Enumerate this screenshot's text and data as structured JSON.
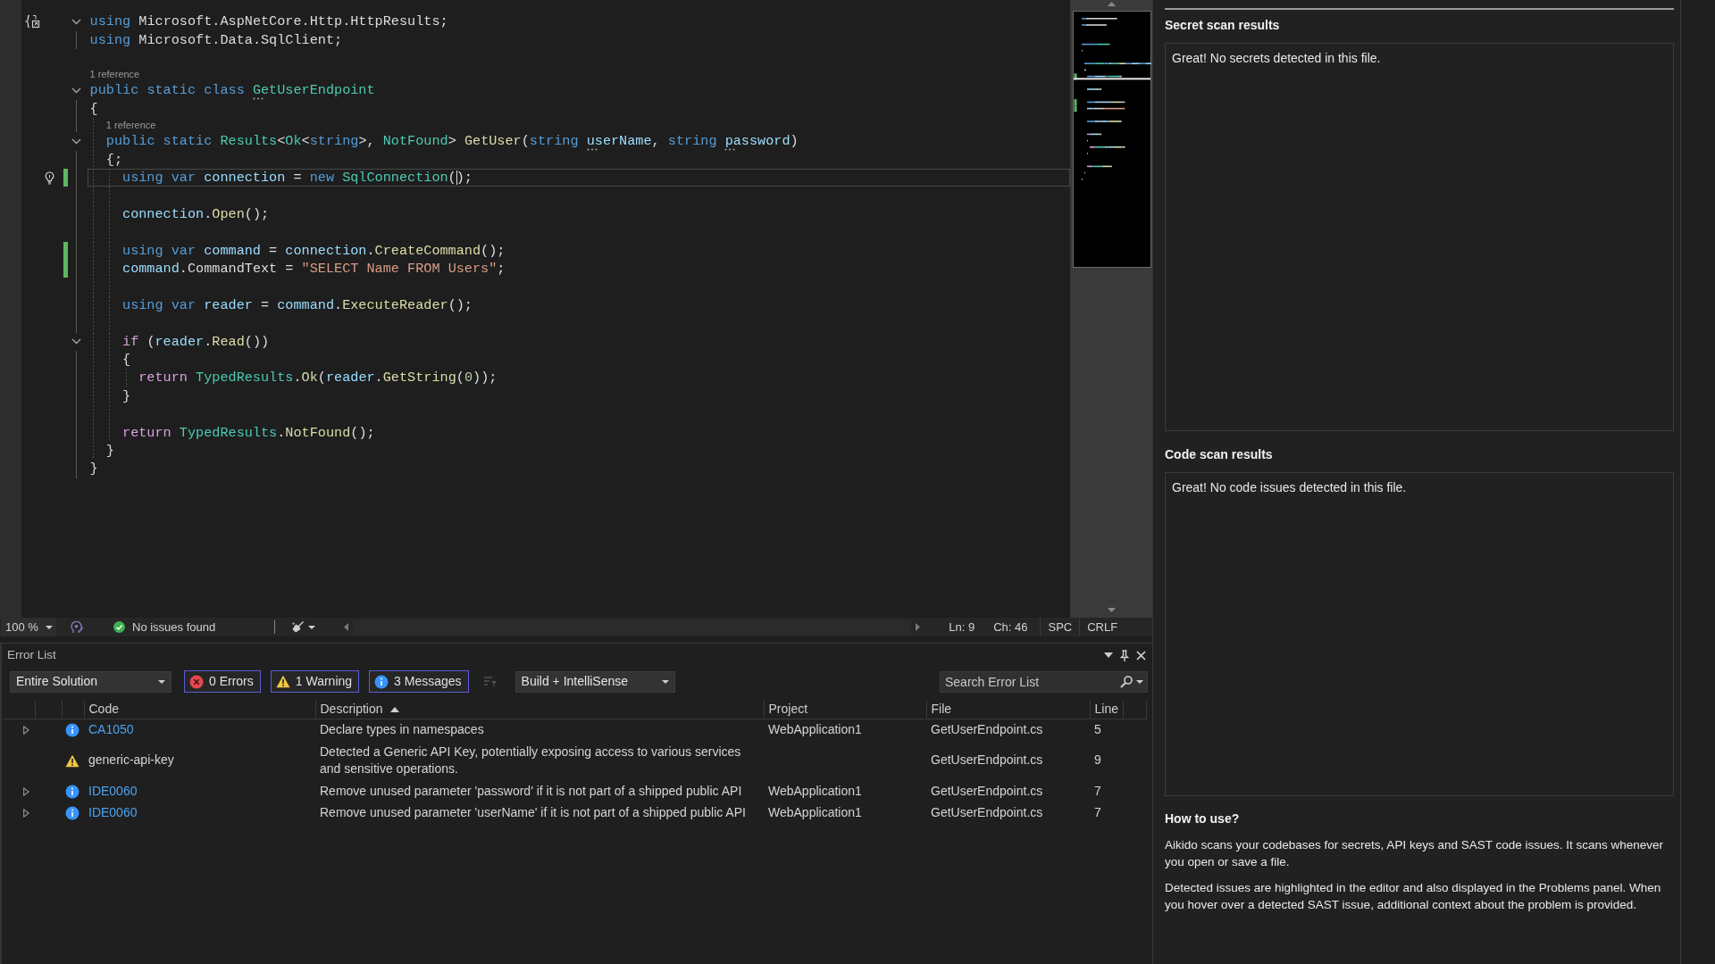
{
  "editor": {
    "lines": [
      {
        "kind": "code",
        "fold": true,
        "modified": false,
        "current": false,
        "tokens": [
          {
            "text": "using",
            "kind": "keyword"
          },
          {
            "text": " Microsoft.AspNetCore.Http.HttpResults;",
            "kind": "plain"
          }
        ]
      },
      {
        "kind": "code",
        "fold": false,
        "modified": false,
        "current": false,
        "tokens": [
          {
            "text": "using",
            "kind": "keyword"
          },
          {
            "text": " Microsoft.Data.SqlClient;",
            "kind": "plain"
          }
        ]
      },
      {
        "kind": "blank",
        "fold": false,
        "modified": false,
        "current": false
      },
      {
        "kind": "codelens",
        "fold": false,
        "modified": false,
        "current": false,
        "text": "1 reference"
      },
      {
        "kind": "code",
        "fold": true,
        "modified": false,
        "current": false,
        "tokens": [
          {
            "text": "public static class ",
            "kind": "keyword"
          },
          {
            "text": "GetUserEndpoint",
            "kind": "type",
            "dotted": true
          }
        ]
      },
      {
        "kind": "code",
        "fold": false,
        "modified": false,
        "current": false,
        "tokens": [
          {
            "text": "{",
            "kind": "plain"
          }
        ],
        "children": [
          {
            "kind": "codelens",
            "fold": false,
            "modified": false,
            "current": false,
            "text": "1 reference"
          },
          {
            "kind": "code",
            "fold": true,
            "modified": false,
            "current": false,
            "tokens": [
              {
                "text": "public static ",
                "kind": "keyword"
              },
              {
                "text": "Results",
                "kind": "type"
              },
              {
                "text": "<",
                "kind": "plain"
              },
              {
                "text": "Ok",
                "kind": "type"
              },
              {
                "text": "<",
                "kind": "plain"
              },
              {
                "text": "string",
                "kind": "keyword"
              },
              {
                "text": ">, ",
                "kind": "plain"
              },
              {
                "text": "NotFound",
                "kind": "type"
              },
              {
                "text": "> ",
                "kind": "plain"
              },
              {
                "text": "GetUser",
                "kind": "method"
              },
              {
                "text": "(",
                "kind": "plain"
              },
              {
                "text": "string ",
                "kind": "keyword"
              },
              {
                "text": "userName",
                "kind": "variable",
                "dotted": true
              },
              {
                "text": ", ",
                "kind": "plain"
              },
              {
                "text": "string ",
                "kind": "keyword"
              },
              {
                "text": "password",
                "kind": "variable",
                "dotted": true
              },
              {
                "text": ")",
                "kind": "plain"
              }
            ]
          },
          {
            "kind": "code",
            "fold": false,
            "modified": false,
            "current": false,
            "tokens": [
              {
                "text": "{;",
                "kind": "plain"
              }
            ],
            "children": [
              {
                "kind": "code",
                "fold": false,
                "modified": true,
                "current": true,
                "tokens": [
                  {
                    "text": "using var ",
                    "kind": "keyword"
                  },
                  {
                    "text": "connection",
                    "kind": "variable"
                  },
                  {
                    "text": " = ",
                    "kind": "plain"
                  },
                  {
                    "text": "new ",
                    "kind": "keyword"
                  },
                  {
                    "text": "SqlConnection",
                    "kind": "type"
                  },
                  {
                    "text": "(",
                    "kind": "plain",
                    "caret": true
                  },
                  {
                    "text": ");",
                    "kind": "plain"
                  }
                ]
              },
              {
                "kind": "blank",
                "fold": false,
                "modified": false,
                "current": false
              },
              {
                "kind": "code",
                "fold": false,
                "modified": false,
                "current": false,
                "tokens": [
                  {
                    "text": "connection",
                    "kind": "variable"
                  },
                  {
                    "text": ".",
                    "kind": "plain"
                  },
                  {
                    "text": "Open",
                    "kind": "method"
                  },
                  {
                    "text": "();",
                    "kind": "plain"
                  }
                ]
              },
              {
                "kind": "blank",
                "fold": false,
                "modified": false,
                "current": false
              },
              {
                "kind": "code",
                "fold": false,
                "modified": true,
                "current": false,
                "tokens": [
                  {
                    "text": "using var ",
                    "kind": "keyword"
                  },
                  {
                    "text": "command",
                    "kind": "variable"
                  },
                  {
                    "text": " = ",
                    "kind": "plain"
                  },
                  {
                    "text": "connection",
                    "kind": "variable"
                  },
                  {
                    "text": ".",
                    "kind": "plain"
                  },
                  {
                    "text": "CreateCommand",
                    "kind": "method"
                  },
                  {
                    "text": "();",
                    "kind": "plain"
                  }
                ]
              },
              {
                "kind": "code",
                "fold": false,
                "modified": true,
                "current": false,
                "tokens": [
                  {
                    "text": "command",
                    "kind": "variable"
                  },
                  {
                    "text": ".",
                    "kind": "plain"
                  },
                  {
                    "text": "CommandText",
                    "kind": "plain"
                  },
                  {
                    "text": " = ",
                    "kind": "plain"
                  },
                  {
                    "text": "\"SELECT Name FROM Users\"",
                    "kind": "string"
                  },
                  {
                    "text": ";",
                    "kind": "plain"
                  }
                ]
              },
              {
                "kind": "blank",
                "fold": false,
                "modified": false,
                "current": false
              },
              {
                "kind": "code",
                "fold": false,
                "modified": false,
                "current": false,
                "tokens": [
                  {
                    "text": "using var ",
                    "kind": "keyword"
                  },
                  {
                    "text": "reader",
                    "kind": "variable"
                  },
                  {
                    "text": " = ",
                    "kind": "plain"
                  },
                  {
                    "text": "command",
                    "kind": "variable"
                  },
                  {
                    "text": ".",
                    "kind": "plain"
                  },
                  {
                    "text": "ExecuteReader",
                    "kind": "method"
                  },
                  {
                    "text": "();",
                    "kind": "plain"
                  }
                ]
              },
              {
                "kind": "blank",
                "fold": false,
                "modified": false,
                "current": false
              },
              {
                "kind": "code",
                "fold": true,
                "modified": false,
                "current": false,
                "tokens": [
                  {
                    "text": "if ",
                    "kind": "control"
                  },
                  {
                    "text": "(",
                    "kind": "plain"
                  },
                  {
                    "text": "reader",
                    "kind": "variable"
                  },
                  {
                    "text": ".",
                    "kind": "plain"
                  },
                  {
                    "text": "Read",
                    "kind": "method"
                  },
                  {
                    "text": "())",
                    "kind": "plain"
                  }
                ]
              },
              {
                "kind": "code",
                "fold": false,
                "modified": false,
                "current": false,
                "tokens": [
                  {
                    "text": "{",
                    "kind": "plain"
                  }
                ],
                "children": [
                  {
                    "kind": "code",
                    "fold": false,
                    "modified": false,
                    "current": false,
                    "tokens": [
                      {
                        "text": "return ",
                        "kind": "control"
                      },
                      {
                        "text": "TypedResults",
                        "kind": "type"
                      },
                      {
                        "text": ".",
                        "kind": "plain"
                      },
                      {
                        "text": "Ok",
                        "kind": "method"
                      },
                      {
                        "text": "(",
                        "kind": "plain"
                      },
                      {
                        "text": "reader",
                        "kind": "variable"
                      },
                      {
                        "text": ".",
                        "kind": "plain"
                      },
                      {
                        "text": "GetString",
                        "kind": "method"
                      },
                      {
                        "text": "(",
                        "kind": "plain"
                      },
                      {
                        "text": "0",
                        "kind": "number"
                      },
                      {
                        "text": "));",
                        "kind": "plain"
                      }
                    ]
                  }
                ]
              },
              {
                "kind": "code",
                "fold": false,
                "modified": false,
                "current": false,
                "tokens": [
                  {
                    "text": "}",
                    "kind": "plain"
                  }
                ]
              },
              {
                "kind": "blank",
                "fold": false,
                "modified": false,
                "current": false
              },
              {
                "kind": "code",
                "fold": false,
                "modified": false,
                "current": false,
                "tokens": [
                  {
                    "text": "return ",
                    "kind": "control"
                  },
                  {
                    "text": "TypedResults",
                    "kind": "type"
                  },
                  {
                    "text": ".",
                    "kind": "plain"
                  },
                  {
                    "text": "NotFound",
                    "kind": "method"
                  },
                  {
                    "text": "();",
                    "kind": "plain"
                  }
                ]
              }
            ]
          },
          {
            "kind": "code",
            "fold": false,
            "modified": false,
            "current": false,
            "tokens": [
              {
                "text": "}",
                "kind": "plain"
              }
            ]
          }
        ]
      },
      {
        "kind": "code",
        "fold": false,
        "modified": false,
        "current": false,
        "tokens": [
          {
            "text": "}",
            "kind": "plain"
          }
        ]
      }
    ]
  },
  "editor_status": {
    "zoom": "100 %",
    "health": "No issues found",
    "line": "Ln: 9",
    "column": "Ch: 46",
    "whitespace": "SPC",
    "line_ending": "CRLF"
  },
  "error_list": {
    "title": "Error List",
    "scope": "Entire Solution",
    "filters": [
      {
        "kind": "error",
        "label": "0 Errors",
        "selected": true
      },
      {
        "kind": "warning",
        "label": "1 Warning",
        "selected": true
      },
      {
        "kind": "message",
        "label": "3 Messages",
        "selected": true
      }
    ],
    "source": "Build + IntelliSense",
    "search": {
      "placeholder": "Search Error List"
    },
    "columns": [
      {
        "label": "Code"
      },
      {
        "label": "Description",
        "sort_ascending": true
      },
      {
        "label": "Project"
      },
      {
        "label": "File"
      },
      {
        "label": "Line"
      }
    ],
    "rows": [
      {
        "kind": "message",
        "expandable": true,
        "link": true,
        "code": "CA1050",
        "description": "Declare types in namespaces",
        "project": "WebApplication1",
        "file": "GetUserEndpoint.cs",
        "line": "5"
      },
      {
        "kind": "warning",
        "expandable": false,
        "link": false,
        "code": "generic-api-key",
        "description": "Detected a Generic API Key, potentially exposing access to various services and sensitive operations.",
        "file": "GetUserEndpoint.cs",
        "line": "9"
      },
      {
        "kind": "message",
        "expandable": true,
        "link": true,
        "code": "IDE0060",
        "description": "Remove unused parameter 'password' if it is not part of a shipped public API",
        "project": "WebApplication1",
        "file": "GetUserEndpoint.cs",
        "line": "7"
      },
      {
        "kind": "message",
        "expandable": true,
        "link": true,
        "code": "IDE0060",
        "description": "Remove unused parameter 'userName' if it is not part of a shipped public API",
        "project": "WebApplication1",
        "file": "GetUserEndpoint.cs",
        "line": "7"
      }
    ]
  },
  "scan_panel": {
    "sections": [
      {
        "title": "Secret scan results",
        "message": "Great! No secrets detected in this file."
      },
      {
        "title": "Code scan results",
        "message": "Great! No code issues detected in this file."
      }
    ],
    "help": {
      "title": "How to use?",
      "paragraphs": [
        "Aikido scans your codebases for secrets, API keys and SAST code issues. It scans whenever you open or save a file.",
        "Detected issues are highlighted in the editor and also displayed in the Problems panel. When you hover over a detected SAST issue, additional context about the problem is provided."
      ]
    }
  }
}
